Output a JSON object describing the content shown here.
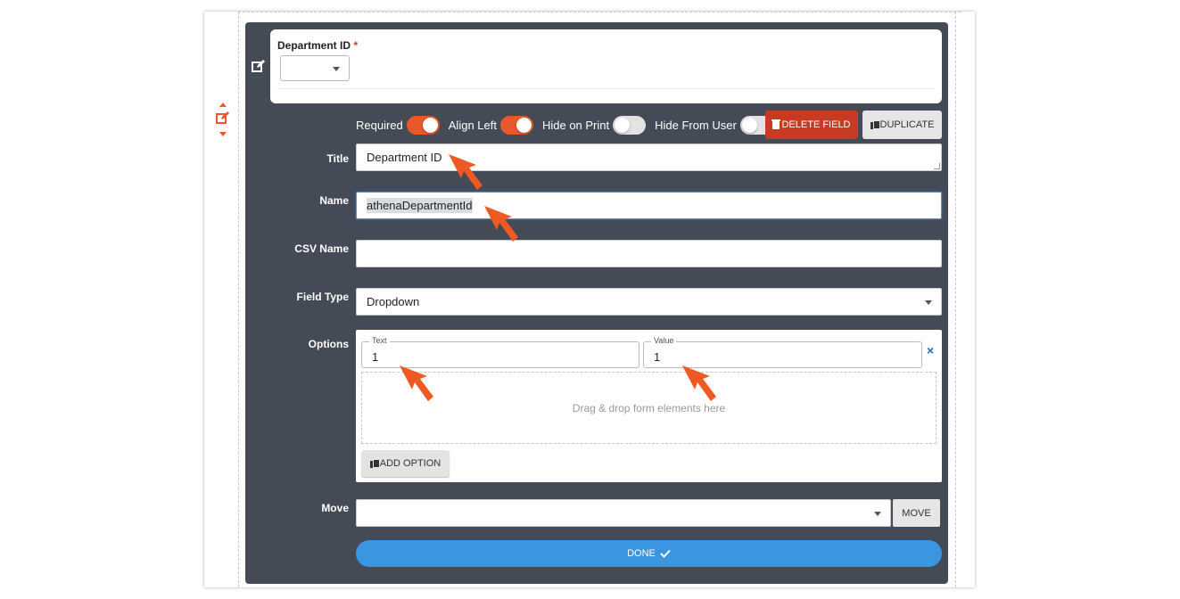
{
  "preview": {
    "label": "Department ID",
    "required_mark": "*",
    "select_value": ""
  },
  "toggles": [
    {
      "label": "Required",
      "on": true
    },
    {
      "label": "Align Left",
      "on": true
    },
    {
      "label": "Hide on Print",
      "on": false
    },
    {
      "label": "Hide From User",
      "on": false
    }
  ],
  "actions": {
    "delete_label": "DELETE FIELD",
    "duplicate_label": "DUPLICATE"
  },
  "fields": {
    "title_label": "Title",
    "title_value": "Department ID",
    "name_label": "Name",
    "name_value": "athenaDepartmentId",
    "csv_label": "CSV Name",
    "csv_value": "",
    "type_label": "Field Type",
    "type_value": "Dropdown",
    "options_label": "Options",
    "move_label": "Move",
    "move_value": ""
  },
  "options": {
    "text_legend": "Text",
    "text_value": "1",
    "value_legend": "Value",
    "value_value": "1",
    "remove_glyph": "×",
    "dropzone_text": "Drag & drop form elements here",
    "add_label": "ADD OPTION"
  },
  "buttons": {
    "move_label": "MOVE",
    "done_label": "DONE"
  },
  "colors": {
    "panel": "#444b56",
    "accent": "#e8582a",
    "delete": "#c93a22",
    "done": "#3a96e0"
  }
}
